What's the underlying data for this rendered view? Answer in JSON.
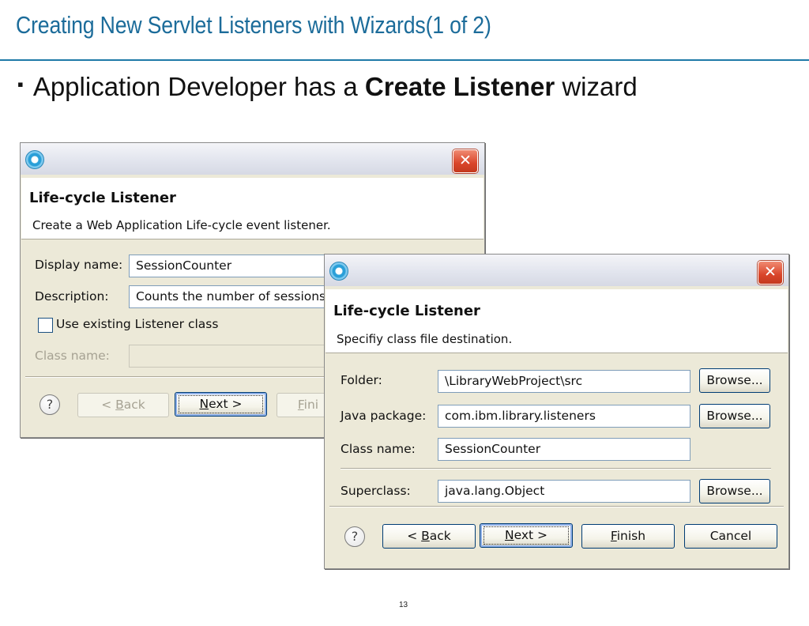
{
  "slide": {
    "title": "Creating New Servlet Listeners with Wizards(1 of 2)",
    "bullet_marker": "▪",
    "bullet_pre": "Application Developer has a",
    "bullet_bold": "Create Listener",
    "bullet_post": "wizard",
    "page_number": "13"
  },
  "colors": {
    "title": "#1c6c9a",
    "rule": "#1f7aa8",
    "dialog_bg": "#ece9d8",
    "close_button": "#d9452a"
  },
  "icons": {
    "app": "eclipse-app-icon",
    "close": "close-x-icon",
    "help": "help-question-icon",
    "checkbox": "checkbox-unchecked"
  },
  "dialog1": {
    "close_glyph": "✕",
    "banner_title": "Life-cycle Listener",
    "banner_subtitle": "Create a Web Application Life-cycle event listener.",
    "display_name_label": "Display name:",
    "display_name_value": "SessionCounter",
    "description_label": "Description:",
    "description_value": "Counts the number of sessions",
    "use_existing_label": "Use existing Listener class",
    "use_existing_checked": false,
    "class_name_label": "Class name:",
    "class_name_value": "",
    "help_glyph": "?",
    "back_pre": "< ",
    "back_mn": "B",
    "back_post": "ack",
    "next_mn": "N",
    "next_post": "ext >",
    "finish_partial_mn": "F",
    "finish_partial_post": "ini"
  },
  "dialog2": {
    "close_glyph": "✕",
    "banner_title": "Life-cycle Listener",
    "banner_subtitle": "Specifiy class file destination.",
    "folder_label": "Folder:",
    "folder_value": "\\LibraryWebProject\\src",
    "java_package_label": "Java package:",
    "java_package_value": "com.ibm.library.listeners",
    "class_name_label": "Class name:",
    "class_name_value": "SessionCounter",
    "superclass_label": "Superclass:",
    "superclass_value": "java.lang.Object",
    "browse_label": "Browse...",
    "help_glyph": "?",
    "back_pre": "< ",
    "back_mn": "B",
    "back_post": "ack",
    "next_mn": "N",
    "next_post": "ext >",
    "finish_mn": "F",
    "finish_post": "inish",
    "cancel_label": "Cancel"
  }
}
